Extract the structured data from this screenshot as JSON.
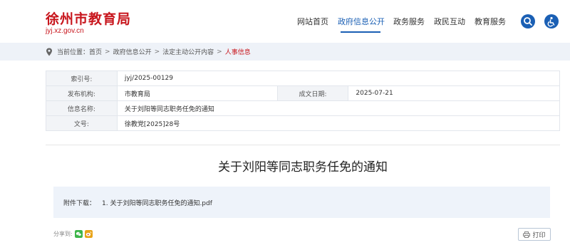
{
  "site": {
    "name": "徐州市教育局",
    "domain": "jyj.xz.gov.cn",
    "brand_color": "#c8161d",
    "accent_color": "#1a5fb4"
  },
  "nav": {
    "items": [
      {
        "label": "网站首页"
      },
      {
        "label": "政府信息公开",
        "active": true
      },
      {
        "label": "政务服务"
      },
      {
        "label": "政民互动"
      },
      {
        "label": "教育服务"
      }
    ],
    "icons": [
      "search-icon",
      "accessibility-icon"
    ]
  },
  "breadcrumb": {
    "prefix": "当前位置：",
    "items": [
      "首页",
      "政府信息公开",
      "法定主动公开内容",
      "人事信息"
    ],
    "separator": ">"
  },
  "meta": {
    "index_label": "索引号:",
    "index_value": "jyj/2025-00129",
    "publisher_label": "发布机构:",
    "publisher_value": "市教育局",
    "date_label": "成文日期:",
    "date_value": "2025-07-21",
    "name_label": "信息名称:",
    "name_value": "关于刘阳等同志职务任免的通知",
    "docno_label": "文号:",
    "docno_value": "徐教党[2025]28号"
  },
  "article": {
    "title": "关于刘阳等同志职务任免的通知"
  },
  "attachment": {
    "label": "附件下载：",
    "file": "1. 关于刘阳等同志职务任免的通知.pdf"
  },
  "share": {
    "label": "分享到:",
    "icons": [
      "wechat-icon",
      "weibo-icon"
    ]
  },
  "print": {
    "label": "打印"
  }
}
